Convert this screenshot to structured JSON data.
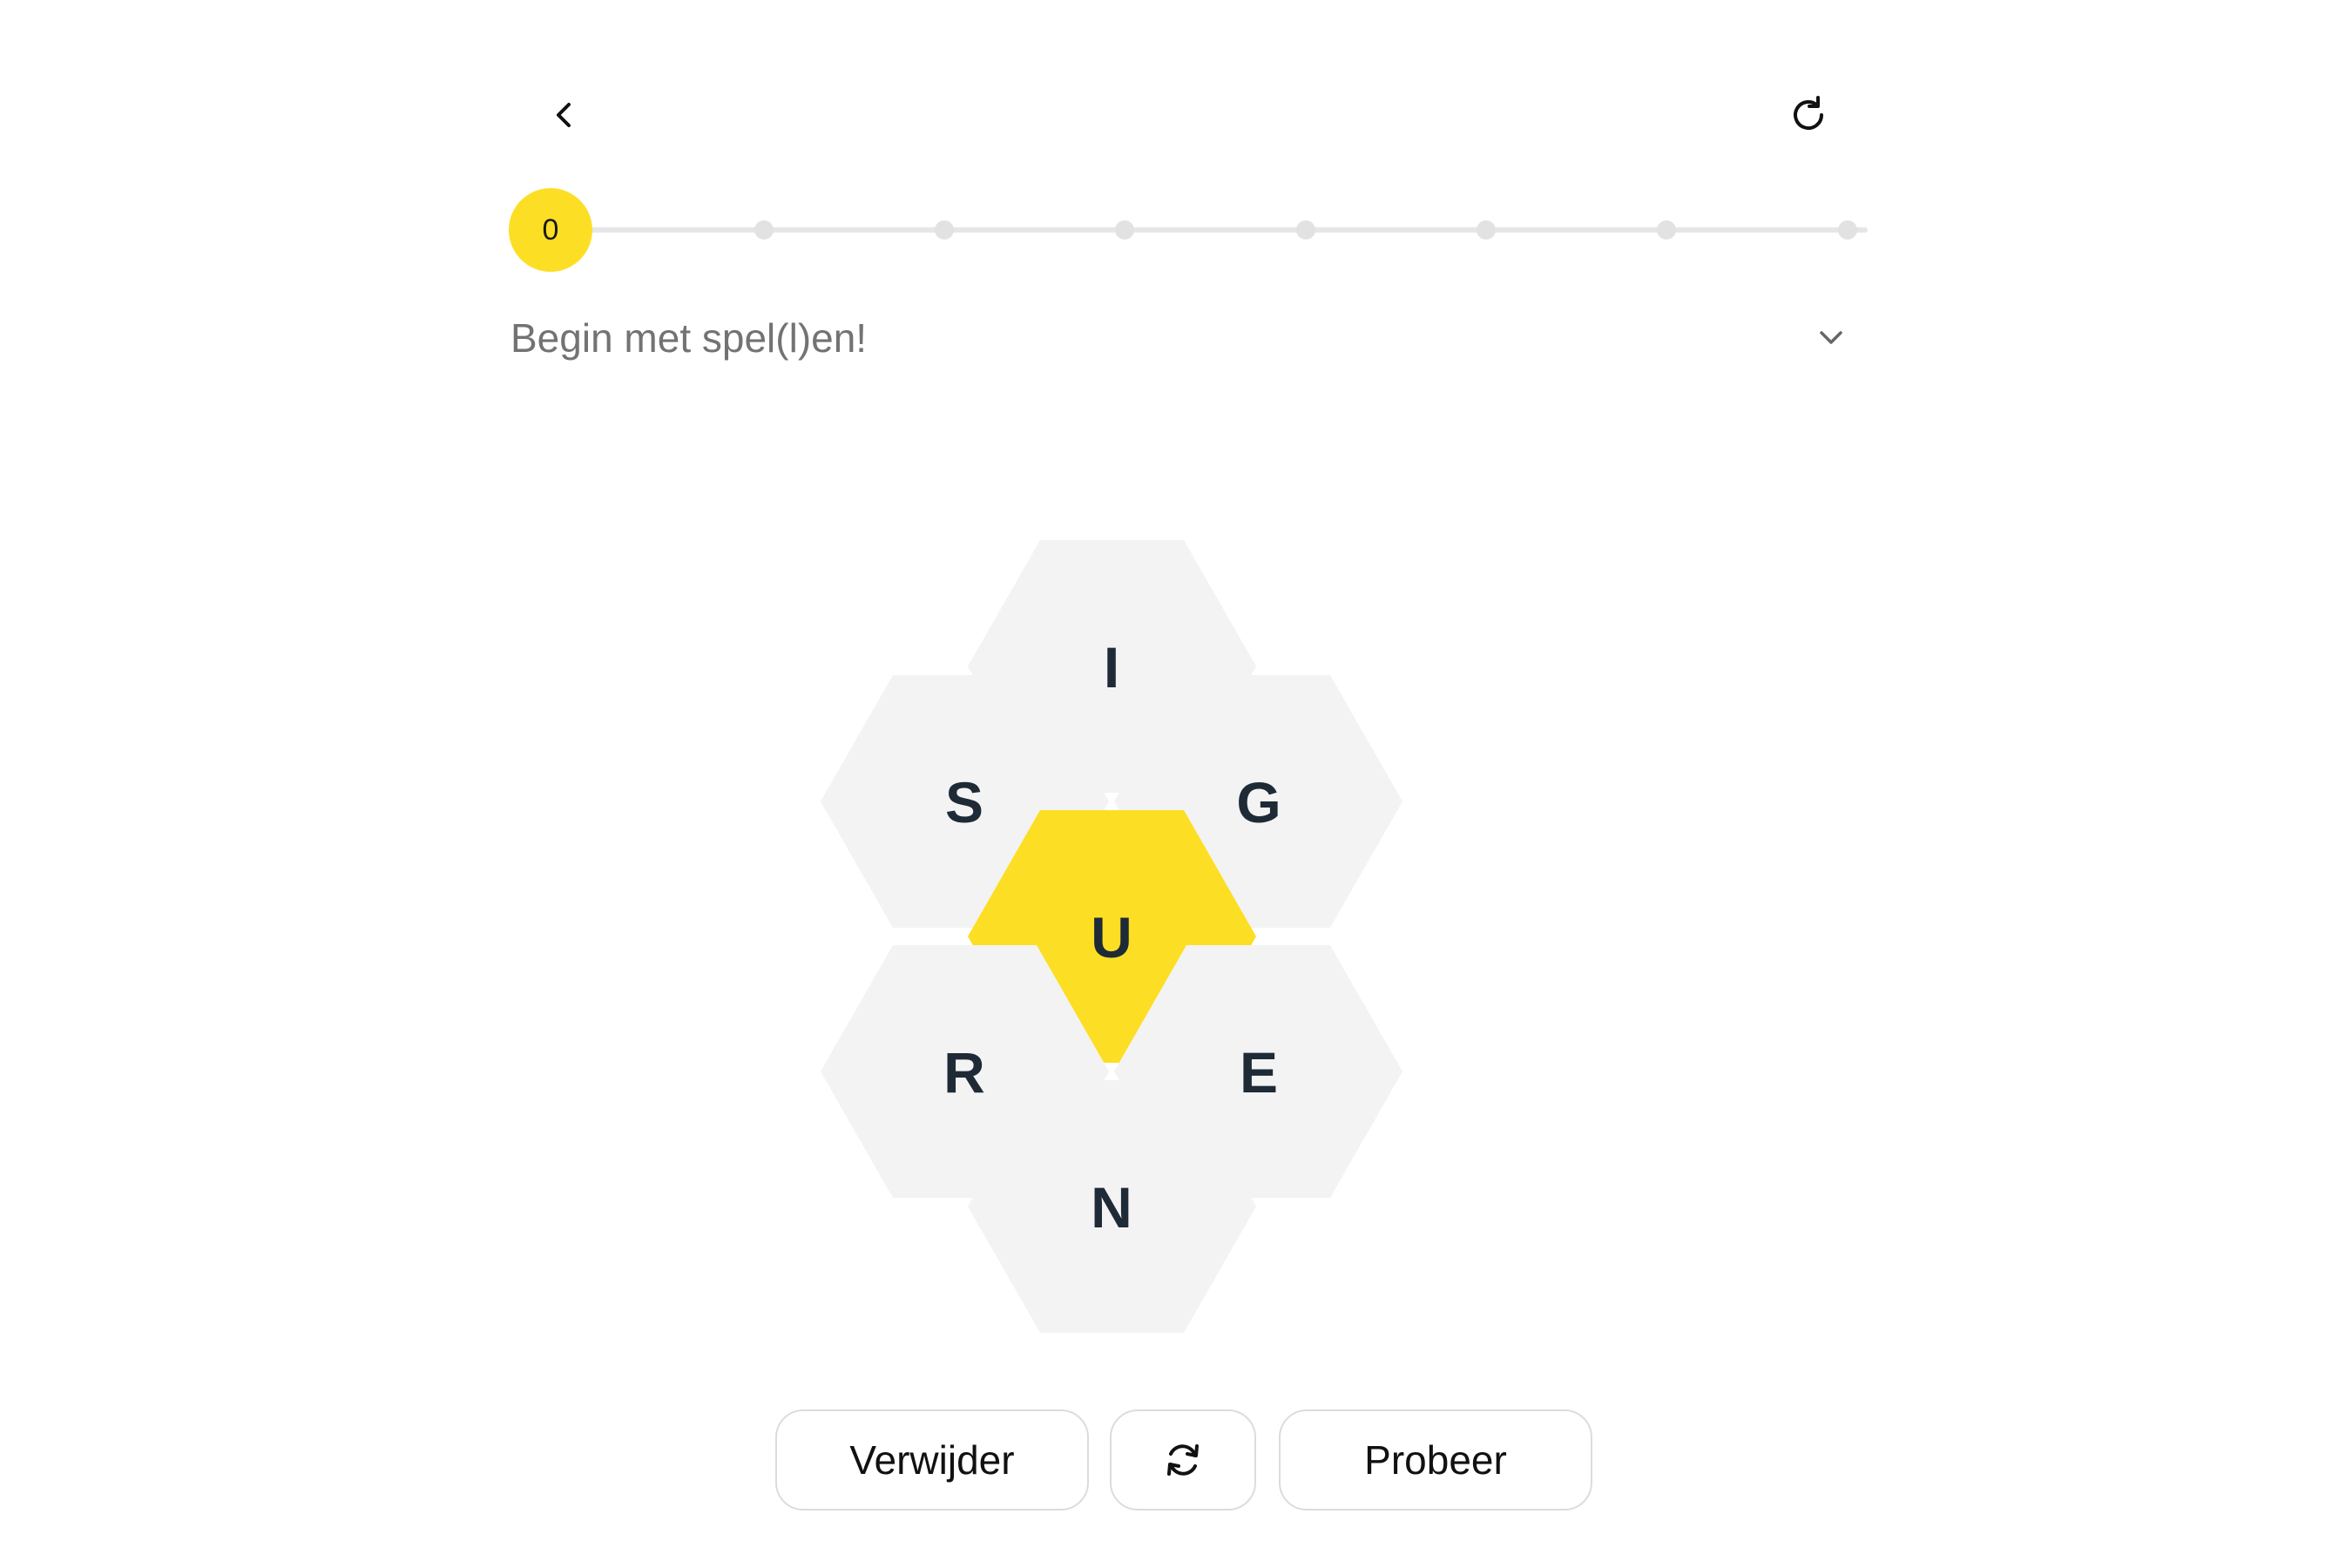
{
  "header": {
    "back_icon": "chevron-left-icon",
    "reset_icon": "refresh-icon"
  },
  "progress": {
    "score": "0",
    "steps": 9,
    "current_step": 0,
    "accent_color": "#fcdf24"
  },
  "rank": {
    "message": "Begin met spel(l)en!",
    "toggle_icon": "chevron-down-icon"
  },
  "hive": {
    "center_letter": "U",
    "outer_letters": {
      "top": "I",
      "upper_left": "S",
      "upper_right": "G",
      "lower_left": "R",
      "lower_right": "E",
      "bottom": "N"
    },
    "center_color": "#fcdf24",
    "outer_color": "#f3f3f3"
  },
  "actions": {
    "delete_label": "Verwijder",
    "shuffle_icon": "shuffle-icon",
    "enter_label": "Probeer"
  }
}
